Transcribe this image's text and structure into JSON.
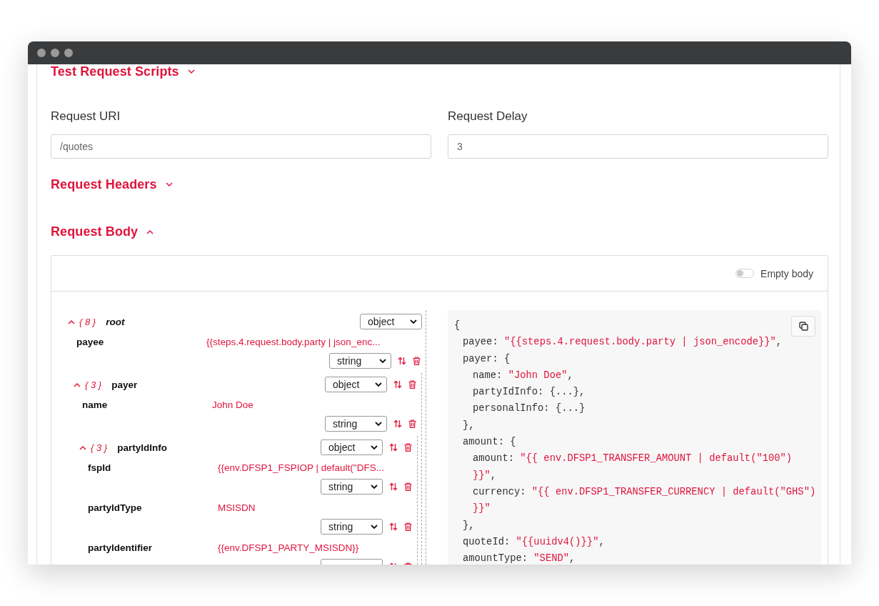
{
  "content": [
    {
      "kind": "section",
      "title": "Test Request Scripts",
      "expanded": false
    },
    {
      "kind": "fields",
      "fields": [
        {
          "label": "Request URI",
          "value": "/quotes"
        },
        {
          "label": "Request Delay",
          "value": "3"
        }
      ]
    },
    {
      "kind": "section",
      "title": "Request Headers",
      "expanded": false
    },
    {
      "kind": "section",
      "title": "Request Body",
      "expanded": true
    }
  ],
  "request_body": {
    "empty_body": {
      "label": "Empty body",
      "on": false
    },
    "tree": {
      "kind": "root",
      "key": "root",
      "count": "{ 8 }",
      "type": "object",
      "expanded": true,
      "children": [
        {
          "kind": "leaf",
          "key": "payee",
          "value": "{{steps.4.request.body.party | json_enc...",
          "type": "string"
        },
        {
          "kind": "object",
          "key": "payer",
          "count": "{ 3 }",
          "type": "object",
          "expanded": true,
          "children": [
            {
              "kind": "leaf",
              "key": "name",
              "value": "John Doe",
              "type": "string"
            },
            {
              "kind": "object",
              "key": "partyIdInfo",
              "count": "{ 3 }",
              "type": "object",
              "expanded": true,
              "children": [
                {
                  "kind": "leaf",
                  "key": "fspId",
                  "value": "{{env.DFSP1_FSPIOP | default(\"DFS...",
                  "type": "string"
                },
                {
                  "kind": "leaf",
                  "key": "partyIdType",
                  "value": "MSISDN",
                  "type": "string"
                },
                {
                  "kind": "leaf",
                  "key": "partyIdentifier",
                  "value": "{{env.DFSP1_PARTY_MSISDN}}"
                }
              ]
            }
          ]
        }
      ]
    },
    "code_lines": [
      {
        "code": "{",
        "children": [
          {
            "key": "payee:",
            "string": "\"{{steps.4.request.body.party | json_encode}}\"",
            "code": ","
          },
          {
            "key": "payer:",
            "code": "{",
            "children": [
              {
                "key": "name:",
                "string": "\"John Doe\"",
                "code": ","
              },
              {
                "key": "partyIdInfo:",
                "code": "{...},"
              },
              {
                "key": "personalInfo:",
                "code": "{...}"
              }
            ]
          },
          {
            "code": "},"
          },
          {
            "key": "amount:",
            "code": "{",
            "children": [
              {
                "key": "amount:",
                "string": "\"{{ env.DFSP1_TRANSFER_AMOUNT | default(\"100\")"
              },
              {
                "string": "}}\"",
                "code": ","
              },
              {
                "key": "currency:",
                "string": "\"{{ env.DFSP1_TRANSFER_CURRENCY | default(\"GHS\")"
              },
              {
                "string": "}}\""
              }
            ]
          },
          {
            "code": "},"
          },
          {
            "key": "quoteId:",
            "string": "\"{{uuidv4()}}\"",
            "code": ","
          },
          {
            "key": "amountType:",
            "string": "\"SEND\"",
            "code": ","
          }
        ]
      }
    ]
  }
}
